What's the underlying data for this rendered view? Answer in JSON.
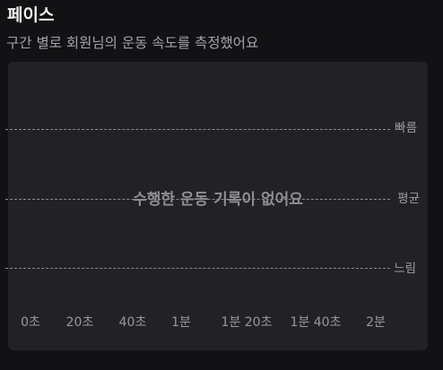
{
  "header": {
    "title": "페이스",
    "subtitle": "구간 별로 회원님의 운동 속도를 측정했어요"
  },
  "chart": {
    "empty_message": "수행한 운동 기록이 없어요",
    "levels": [
      "빠름",
      "평균",
      "느림"
    ],
    "x_ticks": [
      "0초",
      "20초",
      "40초",
      "1분",
      "1분 20초",
      "1분 40초",
      "2분"
    ]
  },
  "chart_data": {
    "type": "line",
    "title": "",
    "xlabel": "",
    "ylabel": "",
    "x_tick_labels": [
      "0초",
      "20초",
      "40초",
      "1분",
      "1분 20초",
      "1분 40초",
      "2분"
    ],
    "y_tick_labels": [
      "느림",
      "평균",
      "빠름"
    ],
    "series": [],
    "grid": "dashed horizontal",
    "annotation": "수행한 운동 기록이 없어요"
  },
  "colors": {
    "background": "#121214",
    "card": "#222226",
    "gridline": "#8a8a90"
  }
}
